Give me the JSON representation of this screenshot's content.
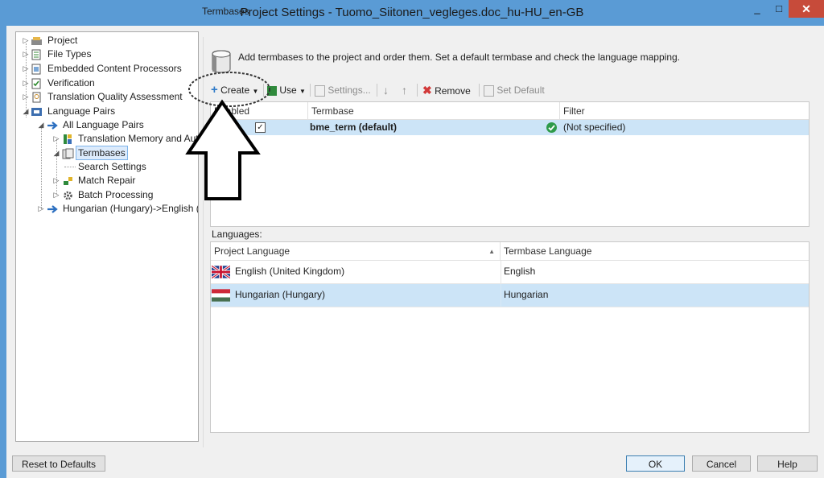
{
  "window": {
    "title": "Project Settings - Tuomo_Siitonen_vegleges.doc_hu-HU_en-GB",
    "minimize": "_",
    "maximize": "□",
    "close": "✕"
  },
  "tree": {
    "items": [
      {
        "label": "Project",
        "icon": "project-icon"
      },
      {
        "label": "File Types",
        "icon": "file-types-icon"
      },
      {
        "label": "Embedded Content Processors",
        "icon": "embedded-content-icon"
      },
      {
        "label": "Verification",
        "icon": "verification-icon"
      },
      {
        "label": "Translation Quality Assessment",
        "icon": "tqa-icon"
      },
      {
        "label": "Language Pairs",
        "icon": "language-pairs-icon"
      },
      {
        "label": "All Language Pairs",
        "icon": "arrow-right-icon"
      },
      {
        "label": "Translation Memory and Aut",
        "icon": "translation-memory-icon"
      },
      {
        "label": "Termbases",
        "icon": "termbase-icon"
      },
      {
        "label": "Search Settings",
        "icon": ""
      },
      {
        "label": "Match Repair",
        "icon": "match-repair-icon"
      },
      {
        "label": "Batch Processing",
        "icon": "gear-icon"
      },
      {
        "label": "Hungarian (Hungary)->English (",
        "icon": "arrow-right-icon"
      }
    ]
  },
  "panel": {
    "group_title": "Termbases",
    "description": "Add termbases to the project and order them. Set a default termbase and check the language mapping.",
    "toolbar": {
      "create": "Create",
      "use": "Use",
      "settings": "Settings...",
      "remove": "Remove",
      "set_default": "Set Default"
    },
    "termbase_table": {
      "headers": {
        "enabled": "Enabled",
        "termbase": "Termbase",
        "filter": "Filter"
      },
      "rows": [
        {
          "enabled": "✓",
          "termbase": "bme_term (default)",
          "filter": "(Not specified)"
        }
      ]
    },
    "languages_label": "Languages:",
    "languages_table": {
      "headers": {
        "project_language": "Project Language",
        "termbase_language": "Termbase Language"
      },
      "rows": [
        {
          "project_language": "English (United Kingdom)",
          "termbase_language": "English"
        },
        {
          "project_language": "Hungarian (Hungary)",
          "termbase_language": "Hungarian"
        }
      ]
    }
  },
  "footer": {
    "reset": "Reset to Defaults",
    "ok": "OK",
    "cancel": "Cancel",
    "help": "Help"
  },
  "colors": {
    "titlebar": "#5a9bd5",
    "selection": "#cce4f7",
    "close": "#c74b3a"
  }
}
